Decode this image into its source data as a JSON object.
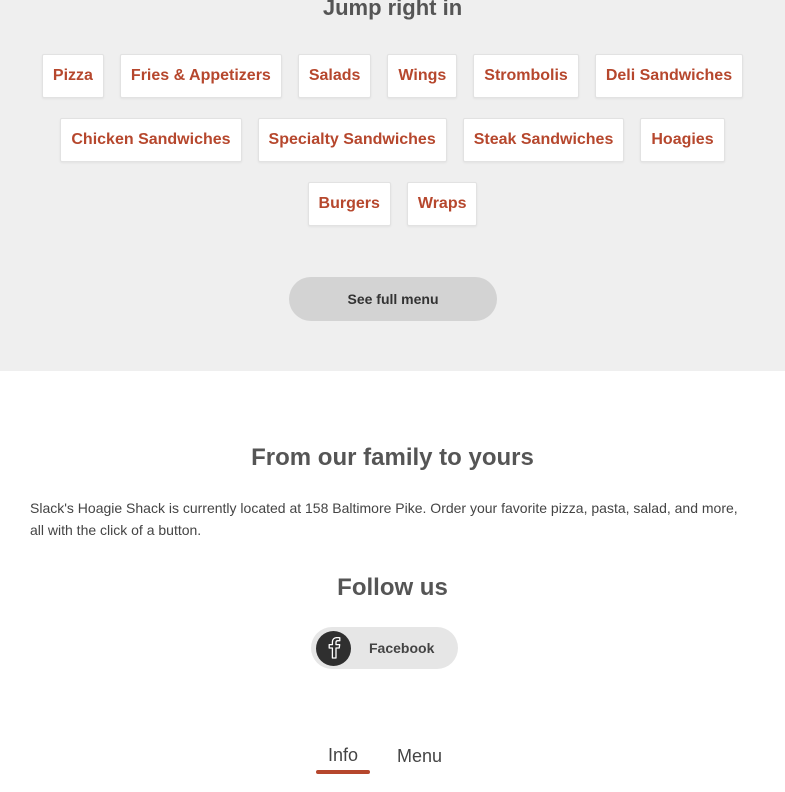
{
  "jump": {
    "title": "Jump right in",
    "rows": [
      [
        "Pizza",
        "Fries & Appetizers",
        "Salads",
        "Wings",
        "Strombolis",
        "Deli Sandwiches"
      ],
      [
        "Chicken Sandwiches",
        "Specialty Sandwiches",
        "Steak Sandwiches",
        "Hoagies"
      ],
      [
        "Burgers",
        "Wraps"
      ]
    ],
    "see_full_label": "See full menu"
  },
  "about": {
    "title": "From our family to yours",
    "text": "Slack's Hoagie Shack is currently located at 158 Baltimore Pike. Order your favorite pizza, pasta, salad, and more, all with the click of a button."
  },
  "follow": {
    "title": "Follow us",
    "facebook_label": "Facebook",
    "icon": "facebook-icon"
  },
  "tabs": {
    "info": "Info",
    "menu": "Menu",
    "active": "Info"
  },
  "colors": {
    "accent": "#b6472d",
    "section_bg": "#efefef"
  }
}
